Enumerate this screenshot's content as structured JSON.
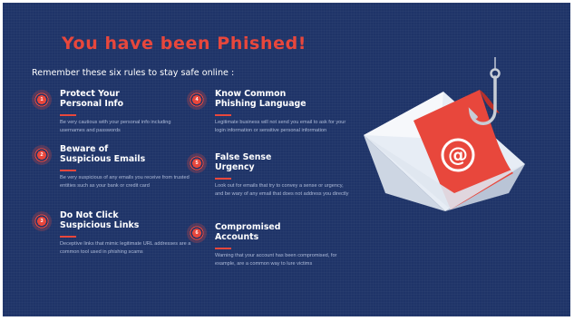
{
  "title": "You have been Phished!",
  "subtitle": "Remember these six rules to stay safe online :",
  "rules": [
    {
      "number": "1",
      "title": "Protect Your\nPersonal Info",
      "body": "Be very cautious with your personal info including usernames and passwords"
    },
    {
      "number": "2",
      "title": "Beware of\nSuspicious Emails",
      "body": "Be very suspicious of any emails you receive from trusted entities such as your bank or credit card"
    },
    {
      "number": "3",
      "title": "Do Not Click\nSuspicious Links",
      "body": "Deceptive links that mimic legitimate URL addresses are a common tool used in phishing scams"
    },
    {
      "number": "4",
      "title": "Know Common\nPhishing Language",
      "body": "Legitimate business will not send you email to ask for your login information or sensitive personal information"
    },
    {
      "number": "5",
      "title": "False Sense\nUrgency",
      "body": "Look out for emails that try to convey a sense or urgency, and be wary of any email that does not address you directly"
    },
    {
      "number": "6",
      "title": "Compromised\nAccounts",
      "body": "Warning that your account has been compromised, for example, are a common way to lure victims"
    }
  ],
  "illustration": {
    "symbol": "@",
    "icons": [
      "fish-hook-icon",
      "envelope-icon",
      "at-sign-icon"
    ]
  },
  "colors": {
    "background": "#1f3468",
    "accent": "#e8473c",
    "text": "#ffffff",
    "muted": "#aebbd9"
  }
}
